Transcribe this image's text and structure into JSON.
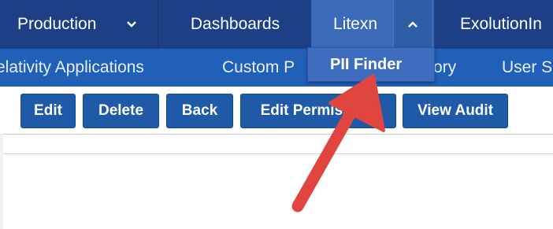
{
  "top_nav": {
    "items": [
      {
        "label": "Production",
        "icon": "chevron-down-icon"
      },
      {
        "label": "Dashboards"
      },
      {
        "label": "Litexn",
        "icon": "chevron-up-icon"
      },
      {
        "label": "ExolutionIn"
      }
    ]
  },
  "sub_nav": {
    "items": [
      {
        "label": "elativity Applications"
      },
      {
        "label": "Custom P"
      },
      {
        "label": "ory"
      },
      {
        "label": "User S"
      }
    ]
  },
  "dropdown": {
    "items": [
      {
        "label": "PII Finder"
      }
    ]
  },
  "toolbar": {
    "buttons": [
      {
        "label": "Edit"
      },
      {
        "label": "Delete"
      },
      {
        "label": "Back"
      },
      {
        "label": "Edit Permiss    s"
      },
      {
        "label": "View Audit"
      }
    ]
  },
  "colors": {
    "top_bar": "#1d3f86",
    "sub_bar": "#2060b8",
    "button": "#1f5aa8",
    "arrow": "#e0453f"
  }
}
